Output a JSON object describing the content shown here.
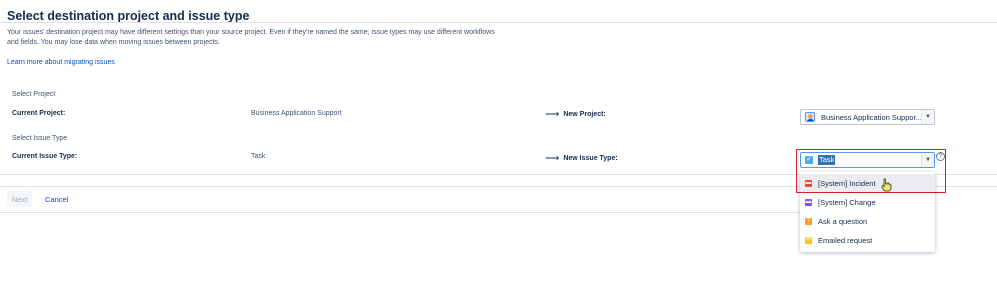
{
  "page": {
    "title": "Select destination project and issue type",
    "description": "Your issues' destination project may have different settings than your source project. Even if they're named the same, issue types may use different workflows and fields. You may lose data when moving issues between projects.",
    "learn_more": "Learn more about migrating issues"
  },
  "project_section": {
    "label": "Select Project",
    "current_label": "Current Project:",
    "current_value": "Business Application Support",
    "new_label": "New Project:",
    "new_value": "Business Application Suppor..."
  },
  "issue_section": {
    "label": "Select Issue Type",
    "current_label": "Current Issue Type:",
    "current_value": "Task",
    "new_label": "New Issue Type:",
    "new_value": "Task"
  },
  "arrow": "⟶",
  "help_glyph": "?",
  "dropdown": {
    "items": [
      {
        "label": "[System] Incident",
        "icon": "incident-icon",
        "color": "#e5493a",
        "glyph": "▬"
      },
      {
        "label": "[System] Change",
        "icon": "change-icon",
        "color": "#904ee2",
        "glyph": "▬"
      },
      {
        "label": "Ask a question",
        "icon": "question-icon",
        "color": "#ff991f",
        "glyph": "?"
      },
      {
        "label": "Emailed request",
        "icon": "email-icon",
        "color": "#ffc400",
        "glyph": "✉"
      }
    ]
  },
  "actions": {
    "next": "Next",
    "cancel": "Cancel"
  },
  "colors": {
    "link": "#0052cc",
    "highlight_box": "#d11f26",
    "task_icon": "#4bade8",
    "selection": "#3572b0"
  }
}
